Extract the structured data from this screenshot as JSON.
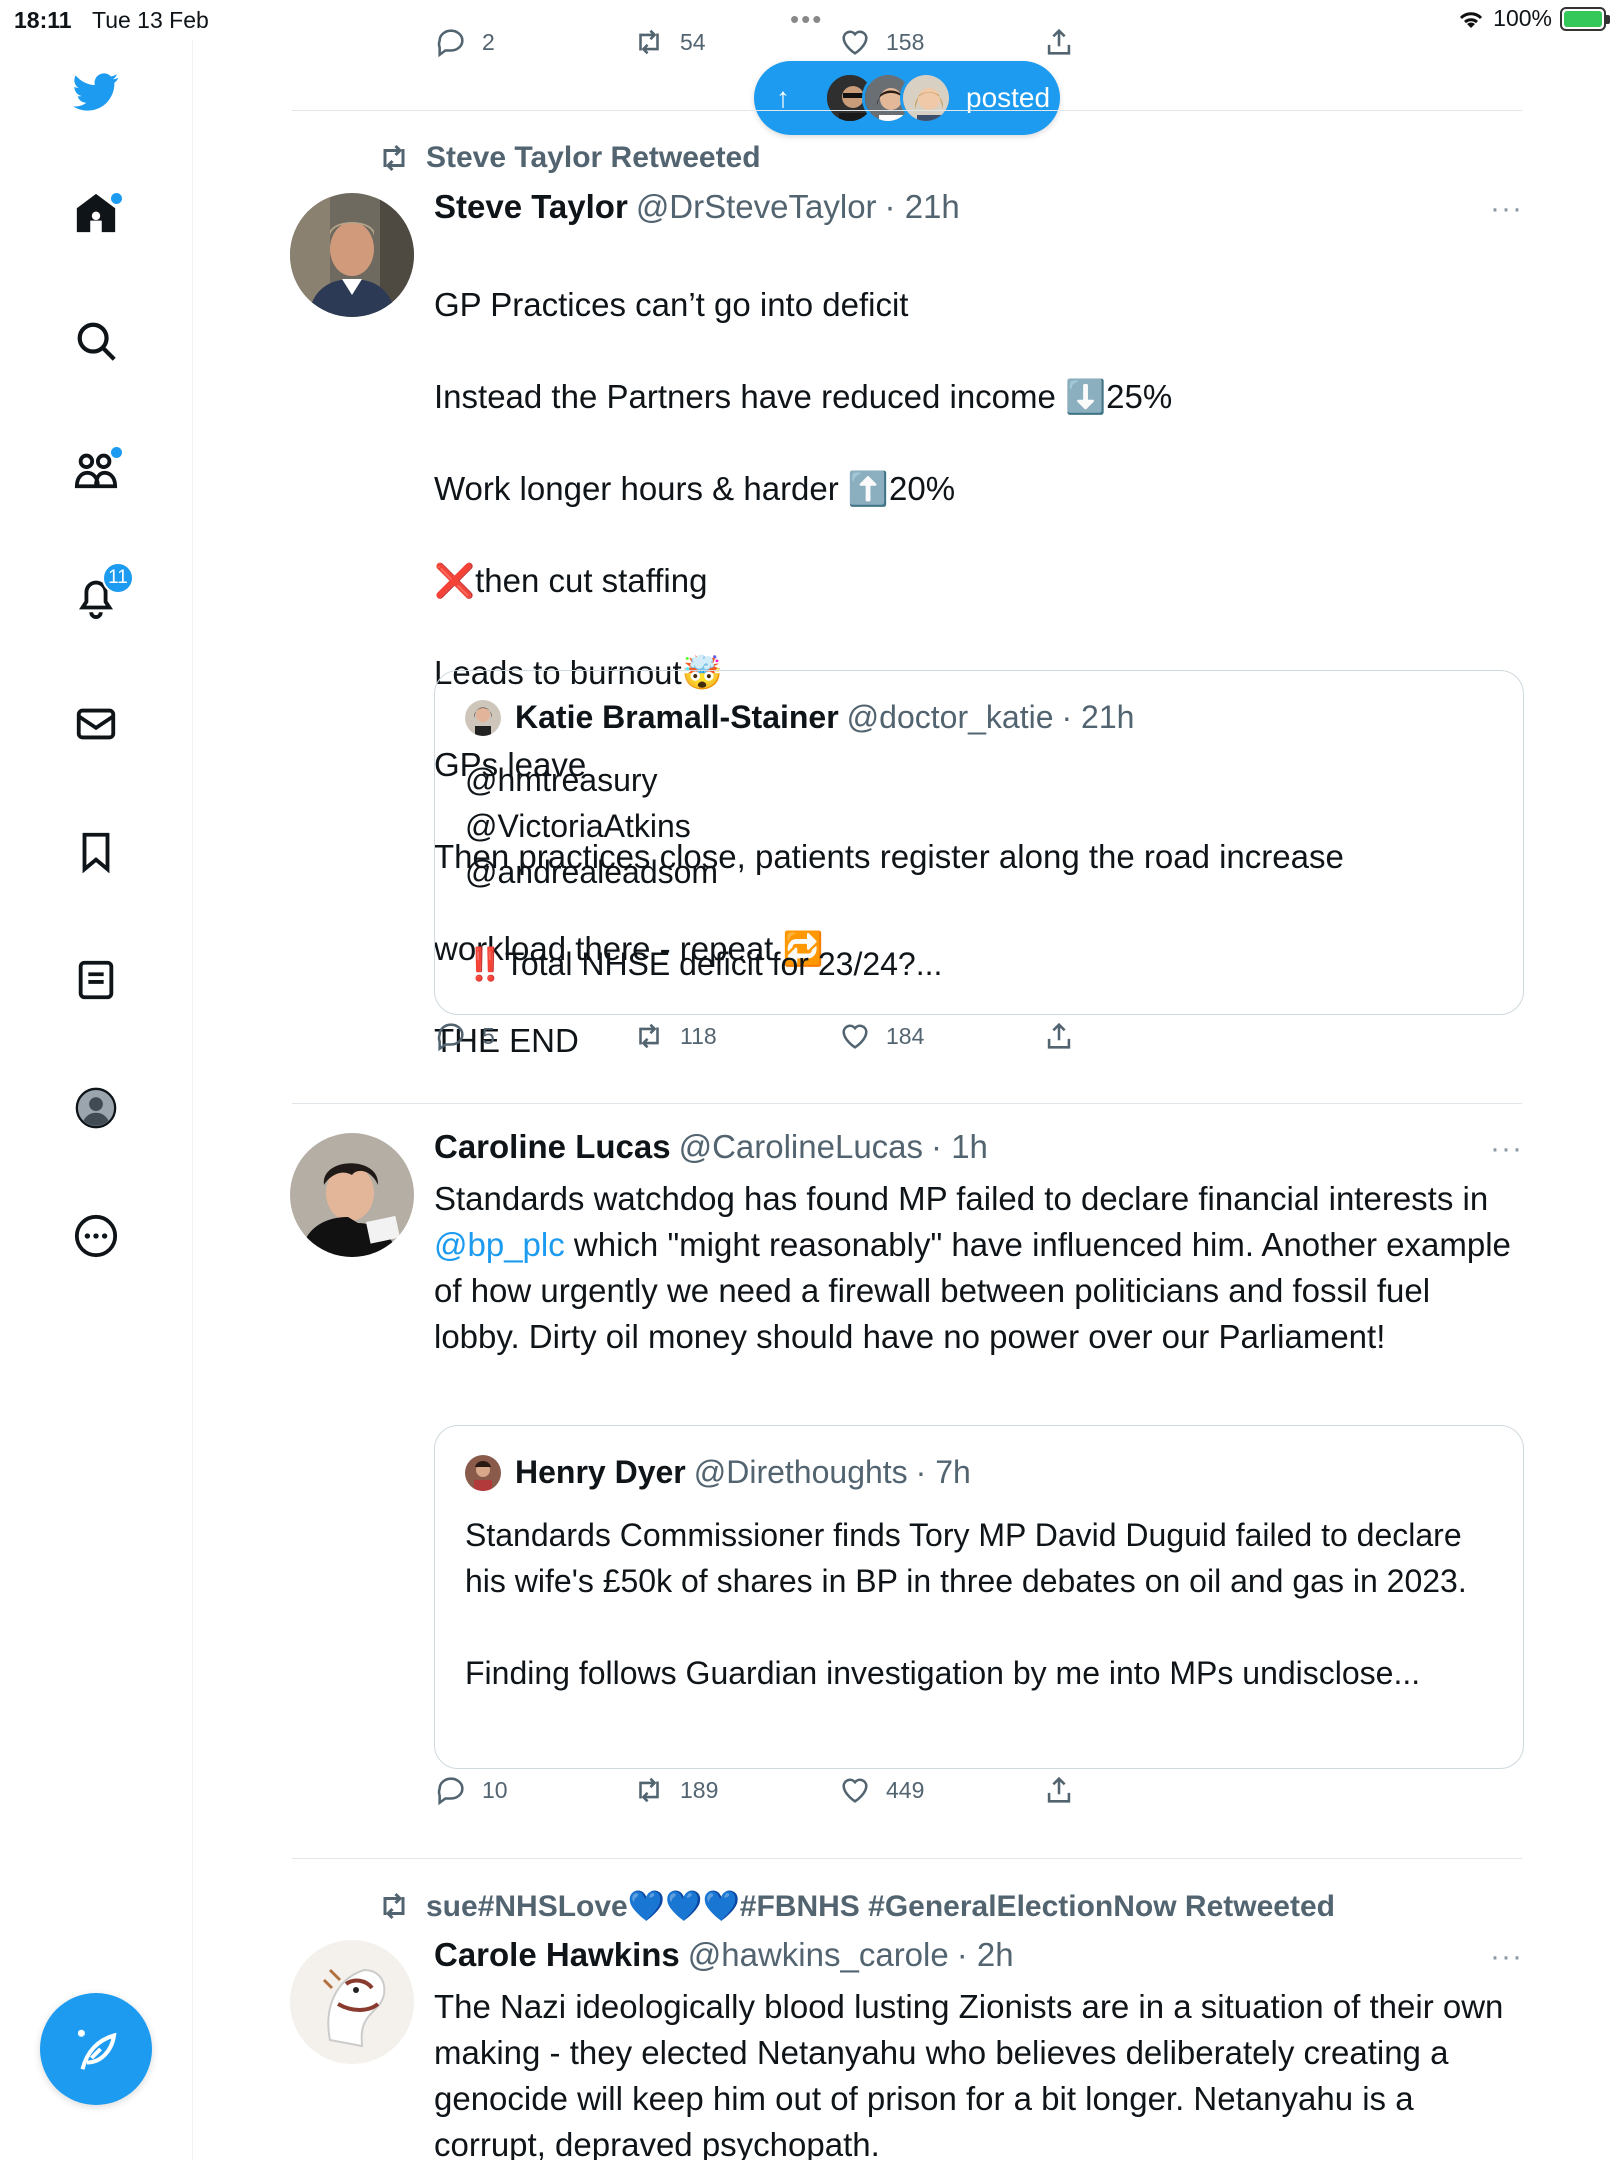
{
  "status_bar": {
    "time": "18:11",
    "date": "Tue 13 Feb",
    "battery": "100%"
  },
  "sidebar": {
    "notifications_count": "11"
  },
  "new_posts_pill": {
    "label": "posted"
  },
  "top_actions": {
    "replies": "2",
    "retweets": "54",
    "likes": "158"
  },
  "tweets": [
    {
      "retweeted_by": "Steve Taylor Retweeted",
      "name": "Steve Taylor",
      "handle": "@DrSteveTaylor",
      "time": "· 21h",
      "lines": [
        "GP Practices can’t go into deficit",
        "Instead the Partners have reduced income ⬇️25%",
        "Work longer hours & harder ⬆️20%",
        "❌then cut staffing",
        "Leads to burnout🤯",
        "GPs leave",
        "Then practices close, patients register along the road increase",
        "workload there - repeat 🔁",
        "THE END"
      ],
      "quote": {
        "name": "Katie Bramall-Stainer",
        "handle": "@doctor_katie",
        "time": "· 21h",
        "text": "@hmtreasury\n@VictoriaAtkins\n@andrealeadsom\n\n‼️Total NHSE deficit for 23/24?..."
      },
      "replies": "5",
      "retweets": "118",
      "likes": "184"
    },
    {
      "name": "Caroline Lucas",
      "handle": "@CarolineLucas",
      "time": "· 1h",
      "text_before": "Standards watchdog has found MP failed to declare financial interests in ",
      "mention": "@bp_plc",
      "text_after": " which \"might reasonably\" have influenced him. Another example of how urgently we need a firewall between politicians and fossil fuel lobby. Dirty oil money should have no power over our Parliament!",
      "quote": {
        "name": "Henry Dyer",
        "handle": "@Direthoughts",
        "time": "· 7h",
        "text": "Standards Commissioner finds Tory MP David Duguid failed to declare his wife's £50k of shares in BP in three debates on oil and gas in 2023.\n\nFinding follows Guardian investigation by me into MPs undisclose..."
      },
      "replies": "10",
      "retweets": "189",
      "likes": "449"
    },
    {
      "retweeted_by": "sue#NHSLove💙💙💙#FBNHS #GeneralElectionNow Retweeted",
      "name": "Carole Hawkins",
      "handle": "@hawkins_carole",
      "time": "· 2h",
      "text": "The Nazi ideologically blood lusting Zionists are in a situation of their own making - they elected Netanyahu who believes deliberately creating a genocide will keep him out of prison for a bit longer. Netanyahu is a corrupt, depraved psychopath."
    }
  ],
  "more_label": "···"
}
